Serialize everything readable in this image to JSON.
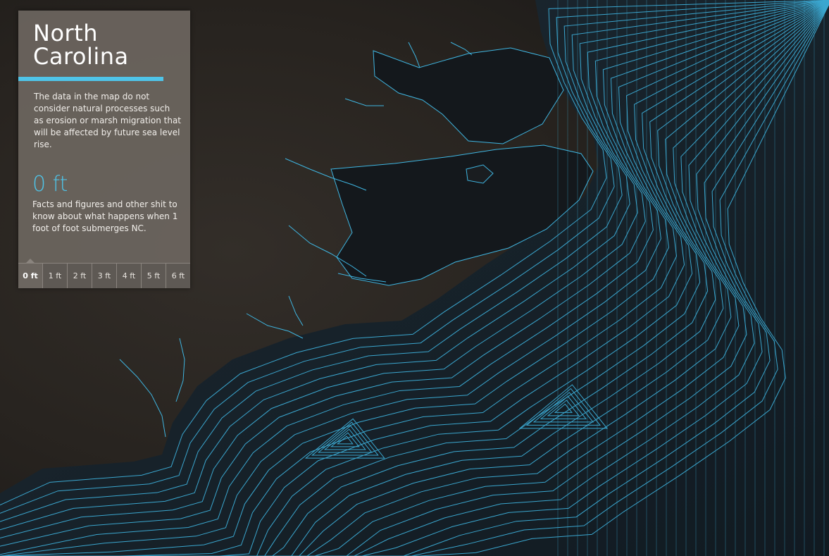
{
  "panel": {
    "title_line1": "North",
    "title_line2": "Carolina",
    "description": "The data in the map do not consider natural processes such as erosion or marsh migration that will be affected by future sea level rise.",
    "level_value": "0 ft",
    "facts": "Facts and figures and other shit to know about what happens when 1 foot of foot submerges NC."
  },
  "sea_level_tabs": [
    {
      "label": "0 ft",
      "active": true
    },
    {
      "label": "1 ft",
      "active": false
    },
    {
      "label": "2 ft",
      "active": false
    },
    {
      "label": "3 ft",
      "active": false
    },
    {
      "label": "4 ft",
      "active": false
    },
    {
      "label": "5 ft",
      "active": false
    },
    {
      "label": "6 ft",
      "active": false
    }
  ],
  "colors": {
    "accent": "#4fc4e8",
    "contour": "#3fb6e2",
    "land": "#2a2622",
    "ocean": "#152029",
    "sound": "#14181c",
    "panel": "#6c6660"
  }
}
